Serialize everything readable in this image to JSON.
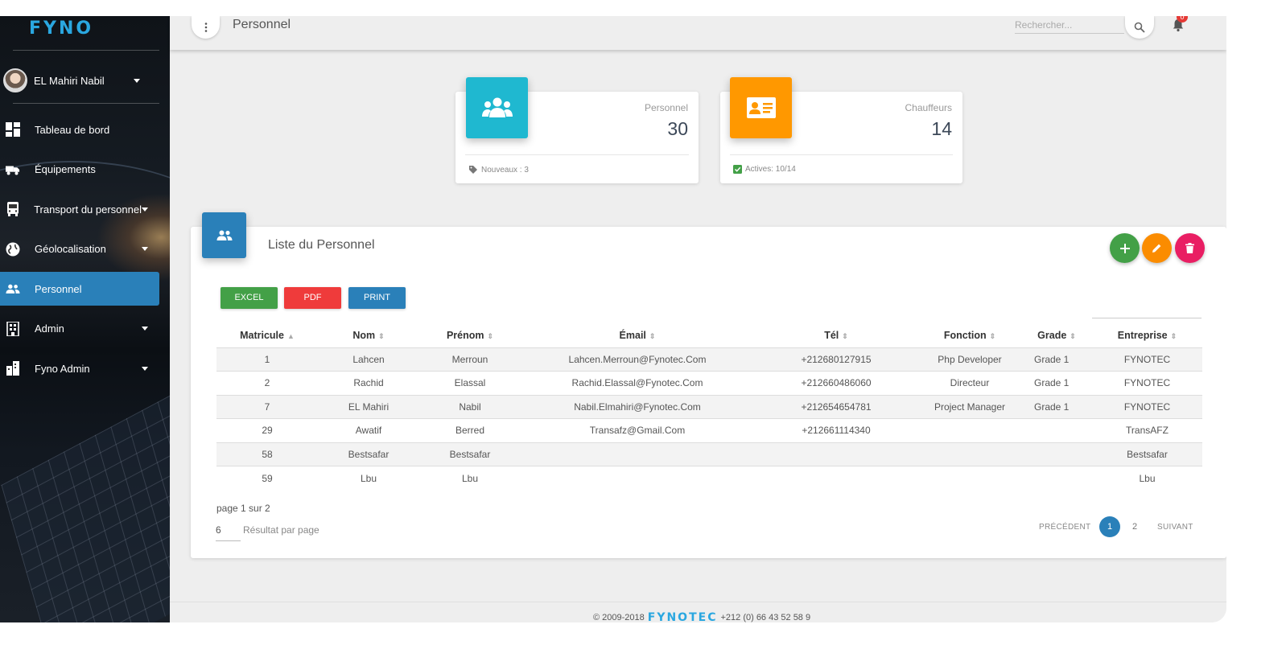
{
  "app": {
    "logo_text": "FYNO",
    "page_title": "Personnel"
  },
  "user": {
    "name": "EL Mahiri Nabil"
  },
  "sidebar": {
    "items": [
      {
        "label": "Tableau de bord",
        "icon": "dashboard-icon",
        "has_caret": false,
        "active": false
      },
      {
        "label": "Équipements",
        "icon": "truck-icon",
        "has_caret": false,
        "active": false
      },
      {
        "label": "Transport du personnel",
        "icon": "bus-icon",
        "has_caret": true,
        "active": false
      },
      {
        "label": "Géolocalisation",
        "icon": "globe-icon",
        "has_caret": true,
        "active": false
      },
      {
        "label": "Personnel",
        "icon": "people-icon",
        "has_caret": false,
        "active": true
      },
      {
        "label": "Admin",
        "icon": "building-icon",
        "has_caret": true,
        "active": false
      },
      {
        "label": "Fyno Admin",
        "icon": "city-icon",
        "has_caret": true,
        "active": false
      }
    ]
  },
  "topbar": {
    "search_placeholder": "Rechercher...",
    "notifications": "0"
  },
  "stats": {
    "personnel": {
      "label": "Personnel",
      "value": "30",
      "footer": "Nouveaux : 3",
      "color": "#1fb8d0"
    },
    "chauffeurs": {
      "label": "Chauffeurs",
      "value": "14",
      "footer": "Actives: 10/14",
      "color": "#ff9800"
    }
  },
  "list": {
    "title": "Liste du Personnel",
    "buttons": {
      "excel": "EXCEL",
      "pdf": "PDF",
      "print": "PRINT"
    },
    "columns": [
      "Matricule",
      "Nom",
      "Prénom",
      "Émail",
      "Tél",
      "Fonction",
      "Grade",
      "Entreprise"
    ],
    "rows": [
      [
        "1",
        "Lahcen",
        "Merroun",
        "Lahcen.Merroun@Fynotec.Com",
        "+212680127915",
        "Php Developer",
        "Grade 1",
        "FYNOTEC"
      ],
      [
        "2",
        "Rachid",
        "Elassal",
        "Rachid.Elassal@Fynotec.Com",
        "+212660486060",
        "Directeur",
        "Grade 1",
        "FYNOTEC"
      ],
      [
        "7",
        "EL Mahiri",
        "Nabil",
        "Nabil.Elmahiri@Fynotec.Com",
        "+212654654781",
        "Project Manager",
        "Grade 1",
        "FYNOTEC"
      ],
      [
        "29",
        "Awatif",
        "Berred",
        "Transafz@Gmail.Com",
        "+212661114340",
        "",
        "",
        "TransAFZ"
      ],
      [
        "58",
        "Bestsafar",
        "Bestsafar",
        "",
        "",
        "",
        "",
        "Bestsafar"
      ],
      [
        "59",
        "Lbu",
        "Lbu",
        "",
        "",
        "",
        "",
        "Lbu"
      ]
    ],
    "page_info": "page 1 sur 2",
    "per_page_value": "6",
    "per_page_label": "Résultat par page",
    "pagination": {
      "prev": "PRÉCÉDENT",
      "pages": [
        "1",
        "2"
      ],
      "current": "1",
      "next": "SUIVANT"
    }
  },
  "footer": {
    "copyright": "© 2009-2018",
    "brand": "FYNOTEC",
    "phone": "+212 (0) 66 43 52 58 9"
  },
  "colors": {
    "primary": "#2a80b9",
    "success": "#43a047",
    "warning": "#fb8c00",
    "danger": "#e91e63",
    "excel": "#43a047",
    "pdf": "#ef3b3b",
    "print": "#2a80b9"
  }
}
